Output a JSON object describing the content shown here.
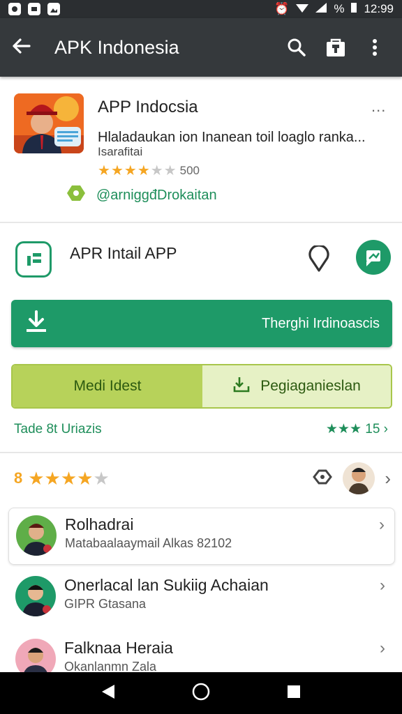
{
  "status_bar": {
    "battery": "%",
    "time": "12:99"
  },
  "app_bar": {
    "title": "APK Indonesia"
  },
  "app": {
    "name": "APP Indocsia",
    "description": "Hlaladaukan ion Inanean toil loaglo ranka...",
    "subtitle": "Isarafitai",
    "rating_count": "500",
    "developer": "@arniggđDrokaitan",
    "more_label": "..."
  },
  "install_row": {
    "label": "APR Intail APP"
  },
  "download_button": {
    "label": "Therghi Irdinoascis"
  },
  "twin_buttons": {
    "left_label": "Medi Idest",
    "right_label": "Pegiaganieslan"
  },
  "trade_row": {
    "left": "Tade 8t Uriazis",
    "right": "★★★ 15 ›"
  },
  "review_header": {
    "score": "8"
  },
  "reviews": [
    {
      "name": "Rolhadrai",
      "sub": "Matabaalaaymail Alkas 82102",
      "avatar_bg": "#5fae48"
    },
    {
      "name": "Onerlacal lan Sukiig Achaian",
      "sub": "GIPR Gtasana",
      "avatar_bg": "#1e9a68"
    },
    {
      "name": "Falknaa Heraia",
      "sub": "Okanlanmn Zala",
      "avatar_bg": "#f0a8b8"
    }
  ],
  "colors": {
    "primary": "#1e9a68",
    "appbar": "#35393c",
    "star": "#f5a623",
    "lime": "#b7d25a"
  }
}
